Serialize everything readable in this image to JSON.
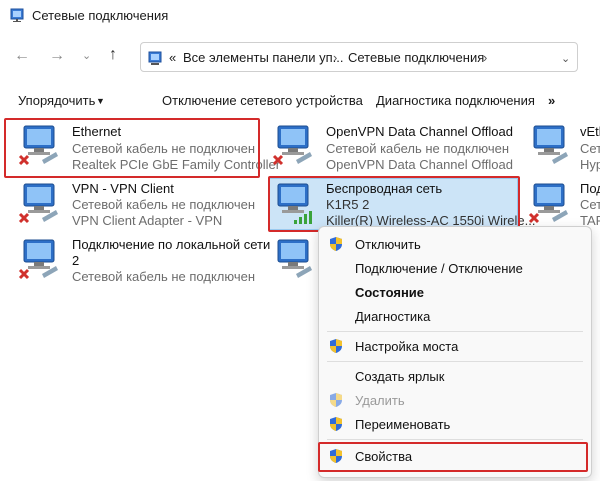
{
  "window": {
    "title": "Сетевые подключения"
  },
  "address": {
    "prefix": "«",
    "segment1": "Все элементы панели уп...",
    "segment2": "Сетевые подключения"
  },
  "toolbar": {
    "organize": "Упорядочить",
    "disable": "Отключение сетевого устройства",
    "diagnose": "Диагностика подключения",
    "more": "»"
  },
  "items": [
    {
      "name": "Ethernet",
      "line2": "Сетевой кабель не подключен",
      "line3": "Realtek PCIe GbE Family Controller"
    },
    {
      "name": "OpenVPN Data Channel Offload",
      "line2": "Сетевой кабель не подключен",
      "line3": "OpenVPN Data Channel Offload"
    },
    {
      "name": "vEth",
      "line2": "Сет",
      "line3": "Hyp"
    },
    {
      "name": "VPN - VPN Client",
      "line2": "Сетевой кабель не подключен",
      "line3": "VPN Client Adapter - VPN"
    },
    {
      "name": "Беспроводная сеть",
      "line2": "K1R5 2",
      "line3": "Killer(R) Wireless-AC 1550i Wirele..."
    },
    {
      "name": "Под",
      "line2": "Сет",
      "line3": "TAP"
    },
    {
      "name": "Подключение по локальной сети",
      "line2": "2",
      "line3": "Сетевой кабель не подключен"
    }
  ],
  "context_menu": {
    "items": [
      "Отключить",
      "Подключение / Отключение",
      "Состояние",
      "Диагностика",
      "Настройка моста",
      "Создать ярлык",
      "Удалить",
      "Переименовать",
      "Свойства"
    ]
  },
  "colors": {
    "highlight_red": "#d42a2a",
    "selection_blue": "#cce4f7",
    "disabled_x": "#d0312d"
  }
}
